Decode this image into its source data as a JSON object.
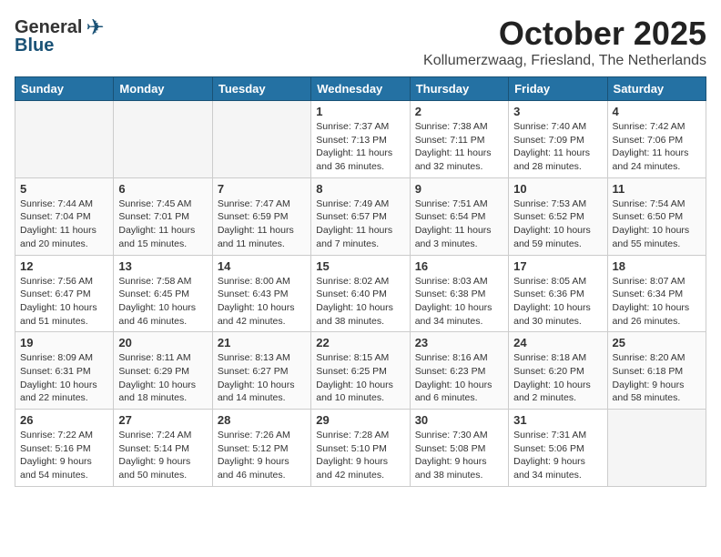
{
  "header": {
    "logo_general": "General",
    "logo_blue": "Blue",
    "month_title": "October 2025",
    "location": "Kollumerzwaag, Friesland, The Netherlands"
  },
  "weekdays": [
    "Sunday",
    "Monday",
    "Tuesday",
    "Wednesday",
    "Thursday",
    "Friday",
    "Saturday"
  ],
  "weeks": [
    [
      {
        "day": "",
        "info": ""
      },
      {
        "day": "",
        "info": ""
      },
      {
        "day": "",
        "info": ""
      },
      {
        "day": "1",
        "info": "Sunrise: 7:37 AM\nSunset: 7:13 PM\nDaylight: 11 hours\nand 36 minutes."
      },
      {
        "day": "2",
        "info": "Sunrise: 7:38 AM\nSunset: 7:11 PM\nDaylight: 11 hours\nand 32 minutes."
      },
      {
        "day": "3",
        "info": "Sunrise: 7:40 AM\nSunset: 7:09 PM\nDaylight: 11 hours\nand 28 minutes."
      },
      {
        "day": "4",
        "info": "Sunrise: 7:42 AM\nSunset: 7:06 PM\nDaylight: 11 hours\nand 24 minutes."
      }
    ],
    [
      {
        "day": "5",
        "info": "Sunrise: 7:44 AM\nSunset: 7:04 PM\nDaylight: 11 hours\nand 20 minutes."
      },
      {
        "day": "6",
        "info": "Sunrise: 7:45 AM\nSunset: 7:01 PM\nDaylight: 11 hours\nand 15 minutes."
      },
      {
        "day": "7",
        "info": "Sunrise: 7:47 AM\nSunset: 6:59 PM\nDaylight: 11 hours\nand 11 minutes."
      },
      {
        "day": "8",
        "info": "Sunrise: 7:49 AM\nSunset: 6:57 PM\nDaylight: 11 hours\nand 7 minutes."
      },
      {
        "day": "9",
        "info": "Sunrise: 7:51 AM\nSunset: 6:54 PM\nDaylight: 11 hours\nand 3 minutes."
      },
      {
        "day": "10",
        "info": "Sunrise: 7:53 AM\nSunset: 6:52 PM\nDaylight: 10 hours\nand 59 minutes."
      },
      {
        "day": "11",
        "info": "Sunrise: 7:54 AM\nSunset: 6:50 PM\nDaylight: 10 hours\nand 55 minutes."
      }
    ],
    [
      {
        "day": "12",
        "info": "Sunrise: 7:56 AM\nSunset: 6:47 PM\nDaylight: 10 hours\nand 51 minutes."
      },
      {
        "day": "13",
        "info": "Sunrise: 7:58 AM\nSunset: 6:45 PM\nDaylight: 10 hours\nand 46 minutes."
      },
      {
        "day": "14",
        "info": "Sunrise: 8:00 AM\nSunset: 6:43 PM\nDaylight: 10 hours\nand 42 minutes."
      },
      {
        "day": "15",
        "info": "Sunrise: 8:02 AM\nSunset: 6:40 PM\nDaylight: 10 hours\nand 38 minutes."
      },
      {
        "day": "16",
        "info": "Sunrise: 8:03 AM\nSunset: 6:38 PM\nDaylight: 10 hours\nand 34 minutes."
      },
      {
        "day": "17",
        "info": "Sunrise: 8:05 AM\nSunset: 6:36 PM\nDaylight: 10 hours\nand 30 minutes."
      },
      {
        "day": "18",
        "info": "Sunrise: 8:07 AM\nSunset: 6:34 PM\nDaylight: 10 hours\nand 26 minutes."
      }
    ],
    [
      {
        "day": "19",
        "info": "Sunrise: 8:09 AM\nSunset: 6:31 PM\nDaylight: 10 hours\nand 22 minutes."
      },
      {
        "day": "20",
        "info": "Sunrise: 8:11 AM\nSunset: 6:29 PM\nDaylight: 10 hours\nand 18 minutes."
      },
      {
        "day": "21",
        "info": "Sunrise: 8:13 AM\nSunset: 6:27 PM\nDaylight: 10 hours\nand 14 minutes."
      },
      {
        "day": "22",
        "info": "Sunrise: 8:15 AM\nSunset: 6:25 PM\nDaylight: 10 hours\nand 10 minutes."
      },
      {
        "day": "23",
        "info": "Sunrise: 8:16 AM\nSunset: 6:23 PM\nDaylight: 10 hours\nand 6 minutes."
      },
      {
        "day": "24",
        "info": "Sunrise: 8:18 AM\nSunset: 6:20 PM\nDaylight: 10 hours\nand 2 minutes."
      },
      {
        "day": "25",
        "info": "Sunrise: 8:20 AM\nSunset: 6:18 PM\nDaylight: 9 hours\nand 58 minutes."
      }
    ],
    [
      {
        "day": "26",
        "info": "Sunrise: 7:22 AM\nSunset: 5:16 PM\nDaylight: 9 hours\nand 54 minutes."
      },
      {
        "day": "27",
        "info": "Sunrise: 7:24 AM\nSunset: 5:14 PM\nDaylight: 9 hours\nand 50 minutes."
      },
      {
        "day": "28",
        "info": "Sunrise: 7:26 AM\nSunset: 5:12 PM\nDaylight: 9 hours\nand 46 minutes."
      },
      {
        "day": "29",
        "info": "Sunrise: 7:28 AM\nSunset: 5:10 PM\nDaylight: 9 hours\nand 42 minutes."
      },
      {
        "day": "30",
        "info": "Sunrise: 7:30 AM\nSunset: 5:08 PM\nDaylight: 9 hours\nand 38 minutes."
      },
      {
        "day": "31",
        "info": "Sunrise: 7:31 AM\nSunset: 5:06 PM\nDaylight: 9 hours\nand 34 minutes."
      },
      {
        "day": "",
        "info": ""
      }
    ]
  ]
}
